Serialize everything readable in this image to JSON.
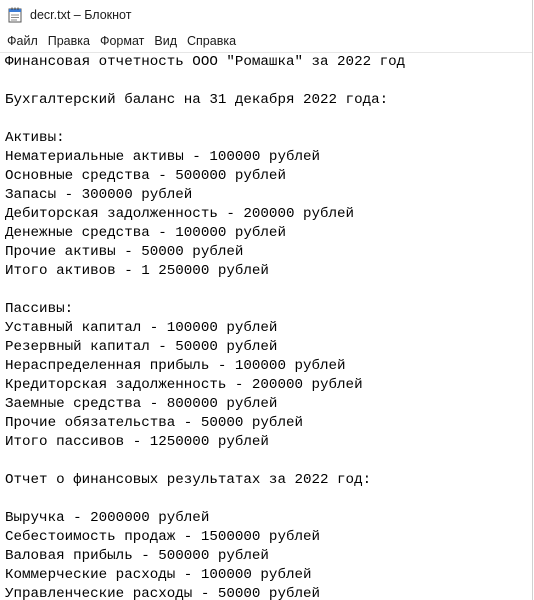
{
  "window": {
    "title": "decr.txt – Блокнот",
    "icon": "notepad-icon"
  },
  "menu": {
    "items": [
      "Файл",
      "Правка",
      "Формат",
      "Вид",
      "Справка"
    ]
  },
  "document": {
    "lines": [
      "Финансовая отчетность ООО \"Ромашка\" за 2022 год",
      "",
      "Бухгалтерский баланс на 31 декабря 2022 года:",
      "",
      "Активы:",
      "Нематериальные активы - 100000 рублей",
      "Основные средства - 500000 рублей",
      "Запасы - 300000 рублей",
      "Дебиторская задолженность - 200000 рублей",
      "Денежные средства - 100000 рублей",
      "Прочие активы - 50000 рублей",
      "Итого активов - 1 250000 рублей",
      "",
      "Пассивы:",
      "Уставный капитал - 100000 рублей",
      "Резервный капитал - 50000 рублей",
      "Нераспределенная прибыль - 100000 рублей",
      "Кредиторская задолженность - 200000 рублей",
      "Заемные средства - 800000 рублей",
      "Прочие обязательства - 50000 рублей",
      "Итого пассивов - 1250000 рублей",
      "",
      "Отчет о финансовых результатах за 2022 год:",
      "",
      "Выручка - 2000000 рублей",
      "Себестоимость продаж - 1500000 рублей",
      "Валовая прибыль - 500000 рублей",
      "Коммерческие расходы - 100000 рублей",
      "Управленческие расходы - 50000 рублей"
    ]
  }
}
